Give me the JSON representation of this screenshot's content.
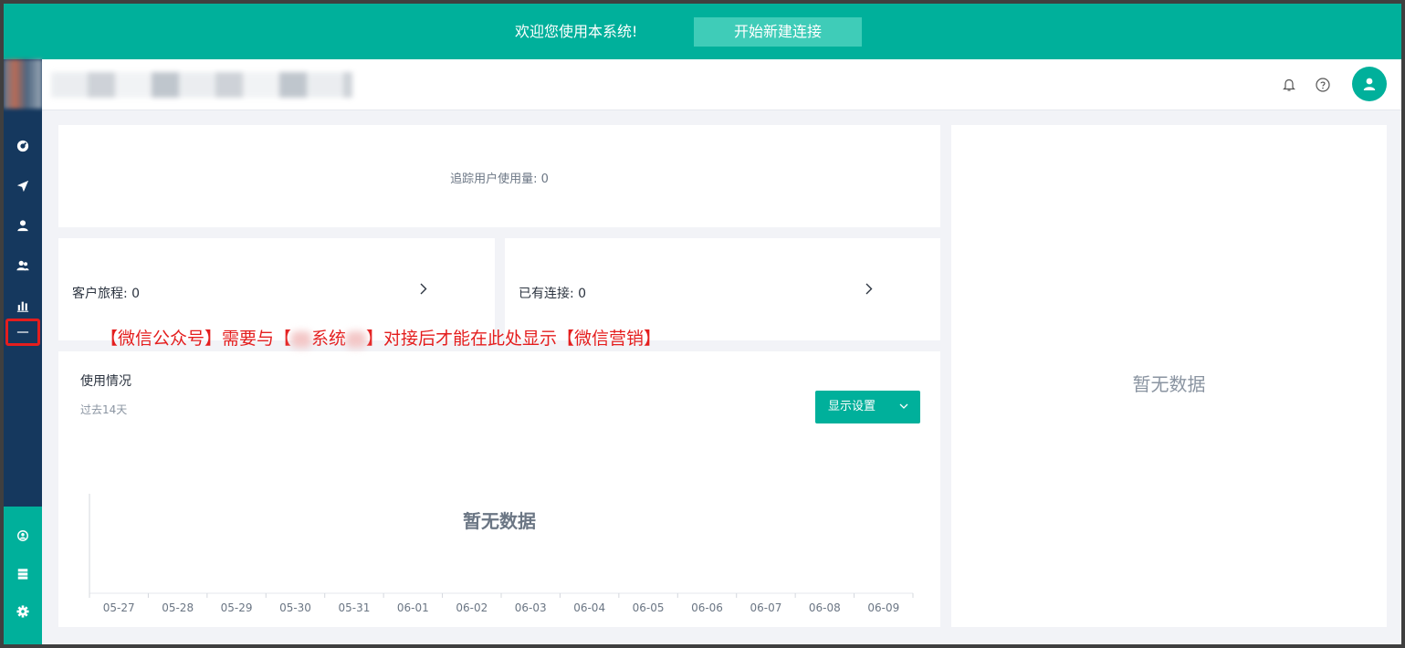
{
  "banner": {
    "welcome": "欢迎您使用本系统!",
    "new_connection_button": "开始新建连接"
  },
  "cards": {
    "tracking": {
      "label": "追踪用户使用量:",
      "value": "0"
    },
    "journey": {
      "label": "客户旅程:",
      "value": "0"
    },
    "connections": {
      "label": "已有连接:",
      "value": "0"
    }
  },
  "usage": {
    "title": "使用情况",
    "subtitle": "过去14天",
    "display_settings": "显示设置",
    "empty": "暂无数据"
  },
  "right_panel": {
    "empty": "暂无数据"
  },
  "annotation": {
    "part1": "【微信公众号】需要与【",
    "part2": "系统",
    "part3": "】对接后才能在此处显示【微信营销】"
  },
  "chart_data": {
    "type": "line",
    "categories": [
      "05-27",
      "05-28",
      "05-29",
      "05-30",
      "05-31",
      "06-01",
      "06-02",
      "06-03",
      "06-04",
      "06-05",
      "06-06",
      "06-07",
      "06-08",
      "06-09"
    ],
    "series": [],
    "title": "",
    "xlabel": "",
    "ylabel": "",
    "empty_message": "暂无数据"
  },
  "colors": {
    "brand": "#00b09b",
    "sidebar": "#15385e",
    "annotation_red": "#e41e1e"
  },
  "icons": {
    "sidebar": [
      "dashboard-icon",
      "send-icon",
      "user-icon",
      "users-icon",
      "bar-chart-icon",
      "wechat-marketing-icon"
    ],
    "sidebar_bottom": [
      "integration-icon",
      "server-icon",
      "settings-icon"
    ],
    "header": [
      "bell-icon",
      "help-icon",
      "avatar-icon"
    ]
  }
}
